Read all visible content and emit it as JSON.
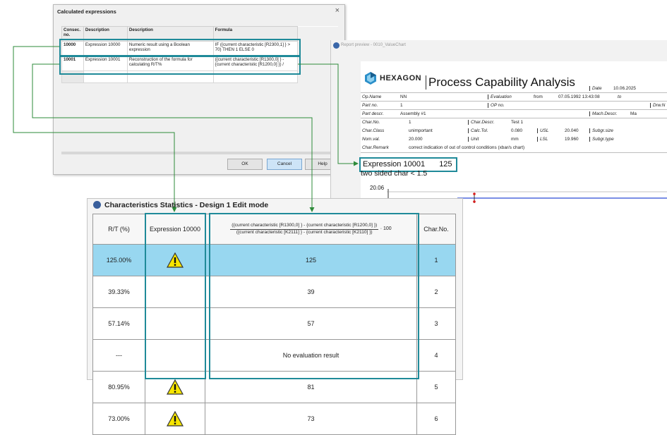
{
  "calc_dialog": {
    "title": "Calculated expressions",
    "close_label": "×",
    "columns": [
      "Consec. no.",
      "Description",
      "Description",
      "Formula"
    ],
    "rows": [
      {
        "no": "10000",
        "name": "Expression 10000",
        "desc": "Numeric result using a Boolean expression",
        "formula": "IF ({current characteristic [R2300,1] } > 70) THEN 1 ELSE 0"
      },
      {
        "no": "10001",
        "name": "Expression 10001",
        "desc": "Reconstruction of the formula for calculating R/T%",
        "formula": "({current characteristic [R1300,0] } - {current characteristic [R1200,0] }) /"
      }
    ],
    "buttons": {
      "ok": "OK",
      "cancel": "Cancel",
      "help": "Help"
    }
  },
  "report": {
    "window_title": "Report preview - 0010_ValueChart",
    "logo_text": "HEXAGON",
    "title": "Process Capability Analysis",
    "fields": {
      "date_label": "Date",
      "date_value": "10.06.2025",
      "op_name_label": "Op.Name",
      "op_name_value": "NN",
      "evaluation_label": "Evaluation",
      "from_label": "from",
      "from_value": "07.05.1992 13:43:08",
      "to_label": "to",
      "part_no_label": "Part no.",
      "part_no_value": "1",
      "op_no_label": "OP no.",
      "drw_label": "Drw.N",
      "part_descr_label": "Part descr.",
      "part_descr_value": "Assembly #1",
      "mach_descr_label": "Mach.Descr.",
      "mach_descr_value": "Ma",
      "char_no_label": "Char.No.",
      "char_no_value": "1",
      "char_descr_label": "Char.Descr.",
      "char_descr_value": "Test 1",
      "char_class_label": "Char.Class",
      "char_class_value": "unimportant",
      "calc_tol_label": "Calc.Tol.",
      "calc_tol_value": "0.080",
      "usl_label": "USL",
      "usl_value": "20.040",
      "subgr_size_label": "Subgr.size",
      "nom_val_label": "Nom.val.",
      "nom_val_value": "20.000",
      "unit_label": "Unit",
      "unit_value": "mm",
      "lsl_label": "LSL",
      "lsl_value": "19.960",
      "subgr_type_label": "Subgr.type",
      "char_remark_label": "Char.Remark",
      "char_remark_value": "correct indication of out of control conditions (xbar/s chart)"
    },
    "expression_label": "Expression 10001",
    "expression_value": "125",
    "two_sided": "two sided char < 1.5",
    "y_tick": "20.06"
  },
  "stats": {
    "title": "Characteristics Statistics - Design 1 Edit mode",
    "headers": {
      "rt": "R/T (%)",
      "expr": "Expression 10000",
      "formula_num": "({current characteristic [R1300,0] } - {current characteristic [R1200,0] })",
      "formula_den": "({current characteristic [K2111] } - {current characteristic [K2110] })",
      "formula_tail": "· 100",
      "charno": "Char.No."
    },
    "rows": [
      {
        "rt": "125.00%",
        "warn": true,
        "value": "125",
        "charno": "1",
        "selected": true
      },
      {
        "rt": "39.33%",
        "warn": false,
        "value": "39",
        "charno": "2",
        "selected": false
      },
      {
        "rt": "57.14%",
        "warn": false,
        "value": "57",
        "charno": "3",
        "selected": false
      },
      {
        "rt": "---",
        "warn": false,
        "value": "No evaluation result",
        "charno": "4",
        "selected": false
      },
      {
        "rt": "80.95%",
        "warn": true,
        "value": "81",
        "charno": "5",
        "selected": false
      },
      {
        "rt": "73.00%",
        "warn": true,
        "value": "73",
        "charno": "6",
        "selected": false
      }
    ]
  },
  "colors": {
    "highlight": "#1f8a99",
    "arrow": "#2e8b3a",
    "selection": "#98d7f0",
    "warning": "#f6e500"
  }
}
